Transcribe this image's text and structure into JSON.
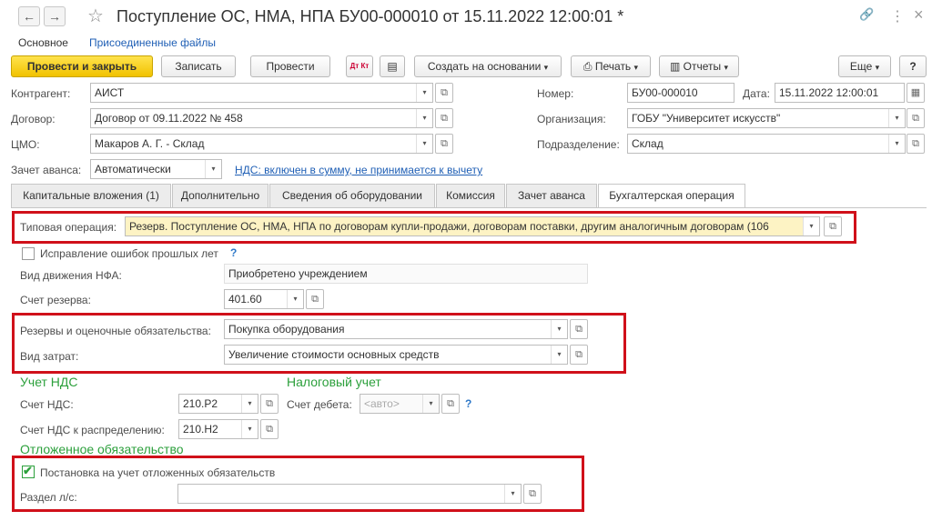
{
  "window": {
    "title": "Поступление ОС, НМА, НПА БУ00-000010 от 15.11.2022 12:00:01 *",
    "back_glyph": "←",
    "forward_glyph": "→",
    "star_glyph": "☆",
    "link_glyph": "🔗",
    "more_glyph": "⋮",
    "close_glyph": "×"
  },
  "top_tabs": {
    "main": "Основное",
    "files": "Присоединенные файлы"
  },
  "toolbar": {
    "post_close": "Провести и закрыть",
    "save": "Записать",
    "post": "Провести",
    "dtkt": "Дт Кт",
    "create_based": "Создать на основании",
    "print": "Печать",
    "reports": "Отчеты",
    "more": "Еще",
    "help": "?"
  },
  "header": {
    "counterparty_label": "Контрагент:",
    "counterparty_value": "АИСТ",
    "contract_label": "Договор:",
    "contract_value": "Договор от 09.11.2022 № 458",
    "cmo_label": "ЦМО:",
    "cmo_value": "Макаров А. Г. - Склад",
    "advance_label": "Зачет аванса:",
    "advance_value": "Автоматически",
    "vat_link": "НДС: включен в сумму, не принимается к вычету",
    "number_label": "Номер:",
    "number_value": "БУ00-000010",
    "date_label": "Дата:",
    "date_value": "15.11.2022 12:00:01",
    "org_label": "Организация:",
    "org_value": "ГОБУ \"Университет искусств\"",
    "dept_label": "Подразделение:",
    "dept_value": "Склад"
  },
  "tabs": [
    {
      "label": "Капитальные вложения (1)"
    },
    {
      "label": "Дополнительно"
    },
    {
      "label": "Сведения об оборудовании"
    },
    {
      "label": "Комиссия"
    },
    {
      "label": "Зачет аванса"
    },
    {
      "label": "Бухгалтерская операция"
    }
  ],
  "accounting": {
    "op_label": "Типовая операция:",
    "op_value": "Резерв. Поступление ОС, НМА, НПА по договорам купли-продажи, договорам поставки, другим аналогичным договорам (106",
    "fix_errors_label": "Исправление ошибок прошлых лет",
    "help_q": "?",
    "nfa_label": "Вид движения НФА:",
    "nfa_value": "Приобретено учреждением",
    "reserve_acc_label": "Счет резерва:",
    "reserve_acc_value": "401.60",
    "reserves_label": "Резервы и оценочные обязательства:",
    "reserves_value": "Покупка оборудования",
    "cost_type_label": "Вид затрат:",
    "cost_type_value": "Увеличение стоимости основных средств",
    "vat_section": "Учет НДС",
    "tax_section": "Налоговый учет",
    "vat_acc_label": "Счет НДС:",
    "vat_acc_value": "210.Р2",
    "debit_acc_label": "Счет дебета:",
    "debit_acc_placeholder": "<авто>",
    "vat_dist_label": "Счет НДС к распределению:",
    "vat_dist_value": "210.Н2",
    "deferred_section": "Отложенное обязательство",
    "deferred_check_label": "Постановка на учет отложенных обязательств",
    "deferred_checked": true,
    "section_label": "Раздел л/с:",
    "section_value": ""
  },
  "colors": {
    "accent_red": "#d0101a",
    "section_green": "#2ca03c",
    "link_blue": "#1f5fb5",
    "primary_yellow": "#f1c200",
    "highlight_field": "#fdf3c4"
  },
  "icons": {
    "dropdown": "▾",
    "open": "⧉",
    "calendar": "▦",
    "checkmark": "✔"
  }
}
